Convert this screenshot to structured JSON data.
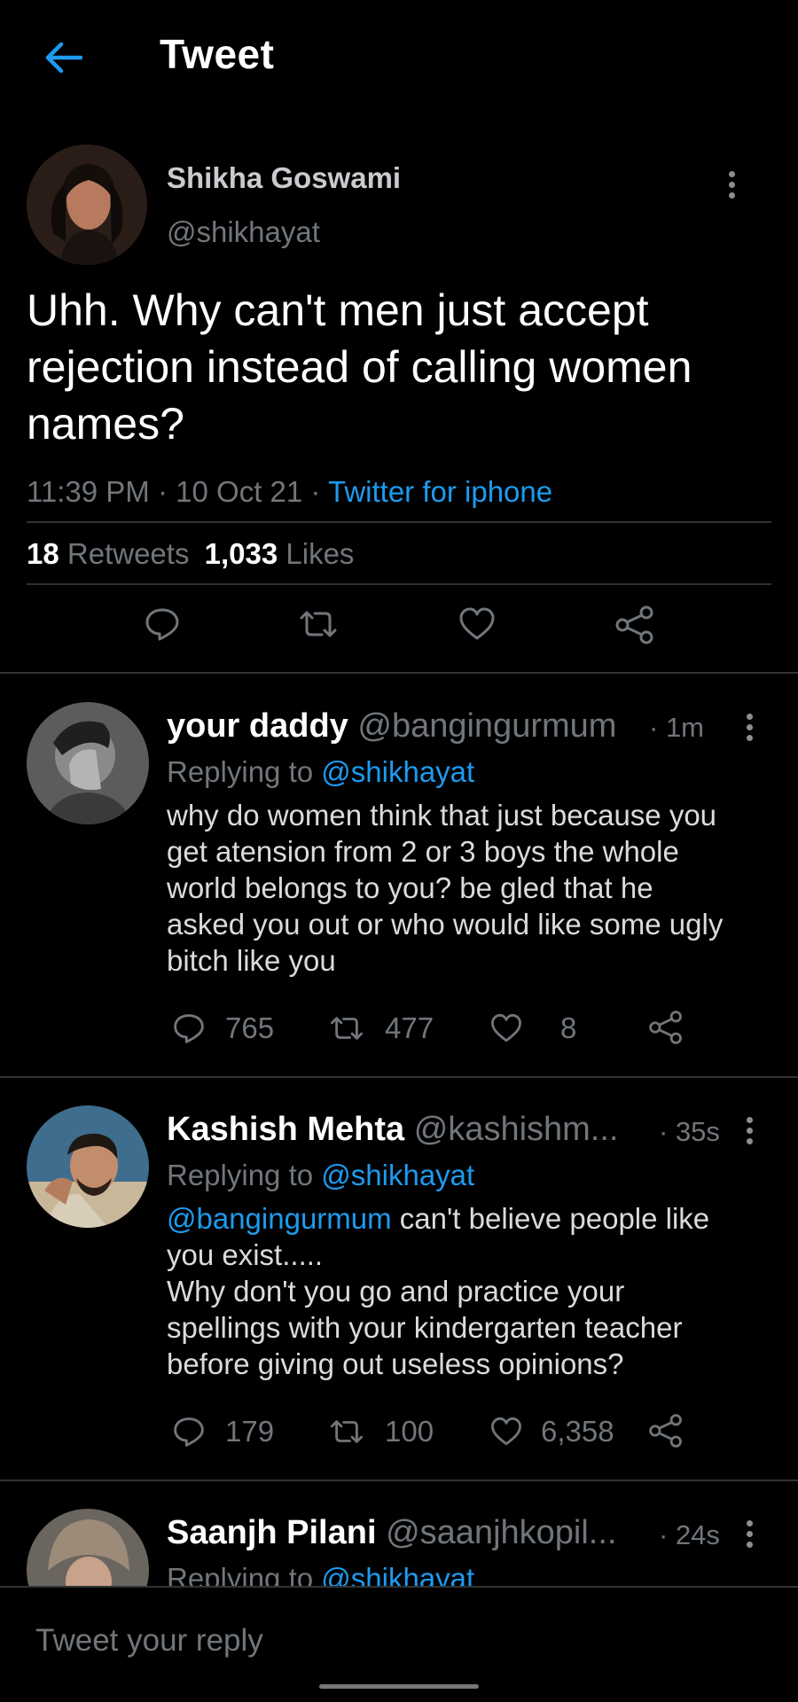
{
  "header": {
    "title": "Tweet",
    "back_icon": "arrow-left-icon",
    "accent": "#1d9bf0"
  },
  "main_tweet": {
    "name": "Shikha Goswami",
    "handle": "@shikhayat",
    "text": "Uhh. Why can't men just accept rejection instead of calling women names?",
    "time": "11:39 PM",
    "date": "10 Oct 21",
    "source": "Twitter for iphone",
    "retweets_count": "18",
    "retweets_label": "Retweets",
    "likes_count": "1,033",
    "likes_label": "Likes"
  },
  "replies": [
    {
      "name": "your daddy",
      "handle": "@bangingurmum",
      "time": "1m",
      "replying_prefix": "Replying to",
      "replying_to": "@shikhayat",
      "mention": "",
      "text": "why do women think that just because you get atension from 2 or 3 boys the whole world belongs to you? be gled that he asked you out or who would like some ugly bitch like you",
      "replies_count": "765",
      "retweets_count": "477",
      "likes_count": "8"
    },
    {
      "name": "Kashish Mehta",
      "handle": "@kashishm...",
      "time": "35s",
      "replying_prefix": "Replying to",
      "replying_to": "@shikhayat",
      "mention": "@bangingurmum",
      "text_line1": " can't believe people like you exist.....",
      "text_line2": "Why don't you go and practice your spellings with your kindergarten teacher before giving out useless opinions?",
      "replies_count": "179",
      "retweets_count": "100",
      "likes_count": "6,358"
    },
    {
      "name": "Saanjh Pilani",
      "handle": "@saanjhkopil...",
      "time": "24s",
      "replying_prefix": "Replying to",
      "replying_to": "@shikhayat"
    }
  ],
  "compose": {
    "placeholder": "Tweet your reply"
  }
}
